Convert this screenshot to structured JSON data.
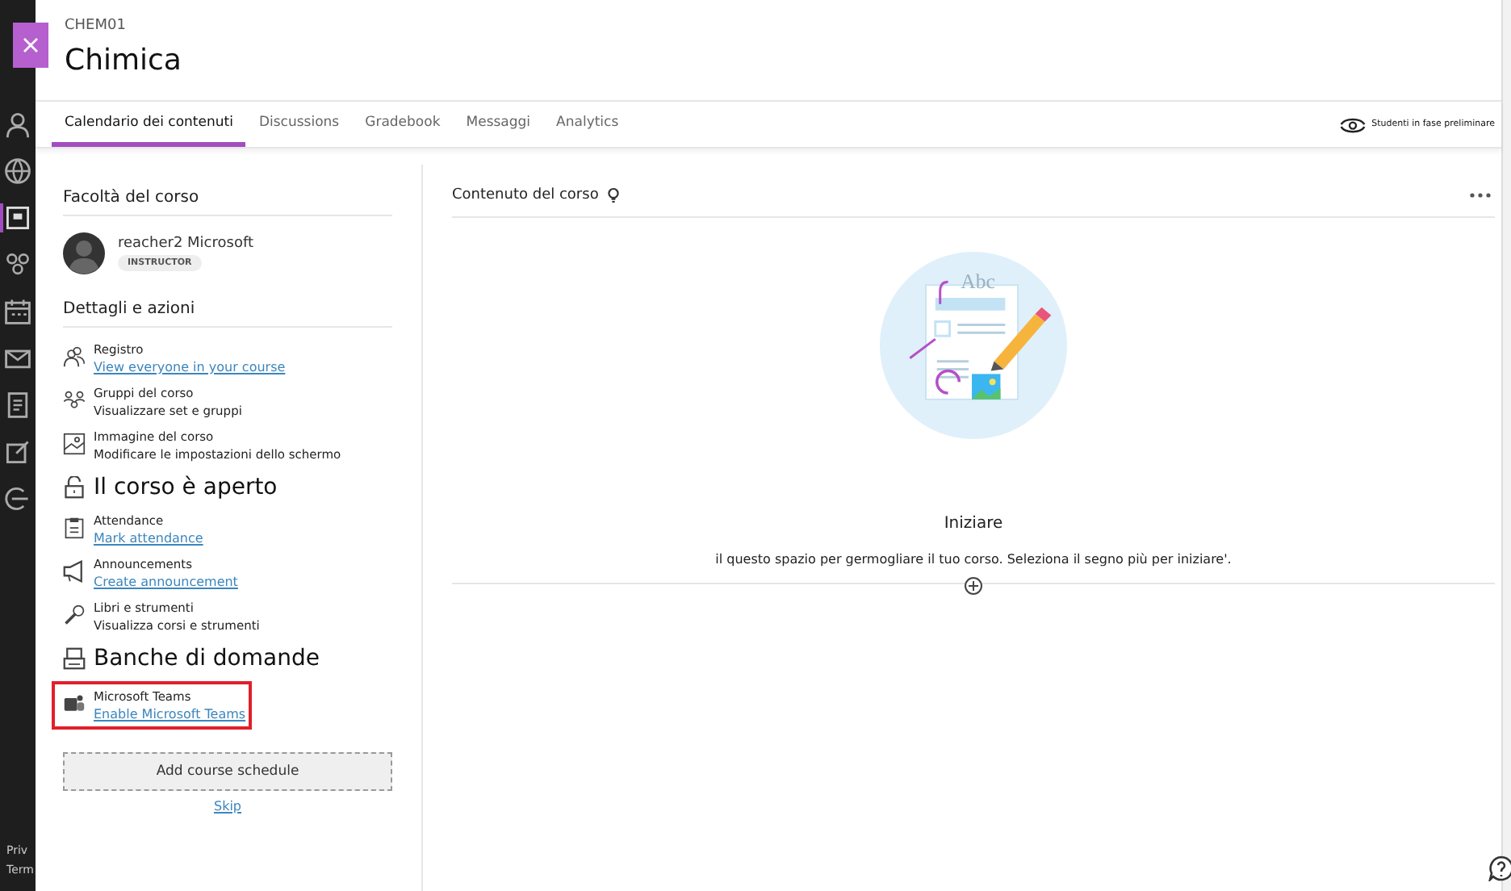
{
  "course": {
    "code": "CHEM01",
    "title": "Chimica"
  },
  "tabs": [
    {
      "label": "Calendario dei contenuti",
      "selected": true
    },
    {
      "label": "Discussions",
      "selected": false
    },
    {
      "label": "Gradebook",
      "selected": false
    },
    {
      "label": "Messaggi",
      "selected": false
    },
    {
      "label": "Analytics",
      "selected": false
    }
  ],
  "student_preview": {
    "label": "Studenti in fase preliminare"
  },
  "faculty": {
    "heading": "Facoltà del corso",
    "name": "reacher2 Microsoft",
    "role": "INSTRUCTOR"
  },
  "details": {
    "heading": "Dettagli e azioni",
    "items": [
      {
        "kind": "normal",
        "title": "Registro",
        "link": "View everyone in your course",
        "highlighted": false
      },
      {
        "kind": "normal",
        "title": "Gruppi del corso",
        "text": "Visualizzare set e gruppi",
        "highlighted": false
      },
      {
        "kind": "normal",
        "title": "Immagine del corso",
        "text": "Modificare le impostazioni dello schermo",
        "highlighted": false
      },
      {
        "kind": "large",
        "title": "Il corso è aperto",
        "highlighted": false
      },
      {
        "kind": "normal",
        "title": "Attendance",
        "link": "Mark attendance",
        "highlighted": false
      },
      {
        "kind": "normal",
        "title": "Announcements",
        "link": "Create announcement",
        "highlighted": false
      },
      {
        "kind": "normal",
        "title": "Libri e strumenti",
        "text": "Visualizza corsi e strumenti",
        "highlighted": false
      },
      {
        "kind": "large",
        "title": "Banche di domande",
        "highlighted": false
      },
      {
        "kind": "normal",
        "title": "Microsoft Teams",
        "link": "Enable Microsoft Teams",
        "highlighted": true
      }
    ]
  },
  "schedule_button": "Add course schedule",
  "skip_link": "Skip",
  "content": {
    "heading": "Contenuto del corso",
    "illustration_label": "Abc",
    "title": "Iniziare",
    "message": "il questo spazio per germogliare il tuo corso. Seleziona il segno più per iniziare'."
  },
  "footer_links": [
    "Priv",
    "Term"
  ]
}
